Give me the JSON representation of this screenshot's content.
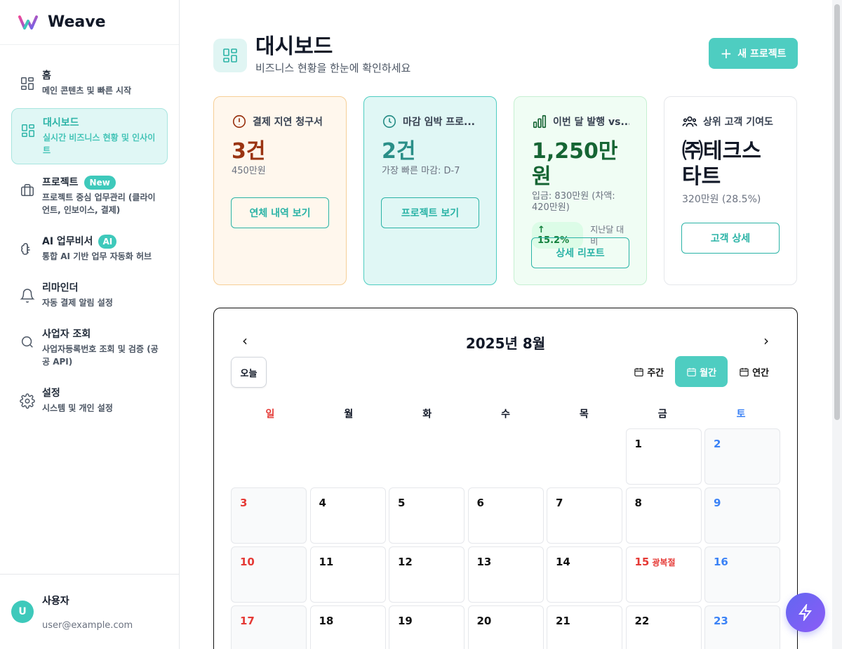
{
  "brand": {
    "name": "Weave"
  },
  "sidebar": {
    "items": [
      {
        "title": "홈",
        "desc": "메인 콘텐츠 및 빠른 시작"
      },
      {
        "title": "대시보드",
        "desc": "실시간 비즈니스 현황 및 인사이트"
      },
      {
        "title": "프로젝트",
        "badge": "New",
        "desc": "프로젝트 중심 업무관리 (클라이언트, 인보이스, 결제)"
      },
      {
        "title": "AI 업무비서",
        "badge": "AI",
        "desc": "통합 AI 기반 업무 자동화 허브"
      },
      {
        "title": "리마인더",
        "desc": "자동 결제 알림 설정"
      },
      {
        "title": "사업자 조회",
        "desc": "사업자등록번호 조회 및 검증 (공공 API)"
      },
      {
        "title": "설정",
        "desc": "시스템 및 개인 설정"
      }
    ]
  },
  "user": {
    "initial": "U",
    "name": "사용자",
    "email": "user@example.com"
  },
  "page": {
    "title": "대시보드",
    "subtitle": "비즈니스 현황을 한눈에 확인하세요",
    "new_project": "새 프로젝트"
  },
  "cards": {
    "overdue": {
      "title": "결제 지연 청구서",
      "value": "3건",
      "sub": "450만원",
      "button": "연체 내역 보기"
    },
    "deadline": {
      "title": "마감 임박 프로...",
      "value": "2건",
      "sub": "가장 빠른 마감: D-7",
      "button": "프로젝트 보기"
    },
    "billing": {
      "title": "이번 달 발행 vs...",
      "value": "1,250만원",
      "sub": "입금: 830만원 (차액: 420만원)",
      "growth": "15.2%",
      "growth_note": "지난달 대비",
      "button": "상세 리포트"
    },
    "top_client": {
      "title": "상위 고객 기여도",
      "value": "㈜테크스타트",
      "sub": "320만원 (28.5%)",
      "button": "고객 상세"
    }
  },
  "calendar": {
    "title": "2025년 8월",
    "today": "오늘",
    "views": {
      "week": "주간",
      "month": "월간",
      "year": "연간"
    },
    "weekdays": [
      "일",
      "월",
      "화",
      "수",
      "목",
      "금",
      "토"
    ],
    "holiday_15": "광복절"
  },
  "colors": {
    "accent": "#4ecdc1",
    "sunday": "#e53935",
    "saturday": "#3b82f6",
    "overdue_value": "#9a3412",
    "deadline_value": "#2a8f88",
    "billing_value": "#166534"
  }
}
